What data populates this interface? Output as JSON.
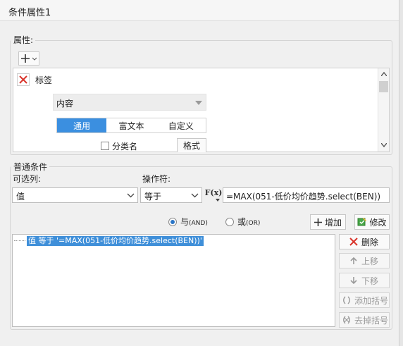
{
  "window": {
    "title": "条件属性1"
  },
  "properties": {
    "group_label": "属性:",
    "item_label": "标签",
    "content_value": "内容",
    "tabs": [
      "通用",
      "富文本",
      "自定义"
    ],
    "category_label": "分类名",
    "format_button": "格式"
  },
  "condition": {
    "group_label": "普通条件",
    "column_label": "可选列:",
    "operator_label": "操作符:",
    "column_value": "值",
    "operator_value": "等于",
    "formula_icon_text": "F(x)",
    "formula_value": "=MAX(051-低价均价趋势.select(BEN))",
    "and_label": "与",
    "and_sub": "(AND)",
    "or_label": "或",
    "or_sub": "(OR)",
    "add_button": "增加",
    "modify_button": "修改",
    "list_item": "值 等于 '=MAX(051-低价均价趋势.select(BEN))'",
    "delete_button": "删除",
    "up_button": "上移",
    "down_button": "下移",
    "add_bracket_button": "添加括号",
    "remove_bracket_button": "去掉括号"
  },
  "colors": {
    "accent": "#3b8fe0",
    "selection": "#3f8fd9",
    "delete_red": "#d9342b"
  }
}
